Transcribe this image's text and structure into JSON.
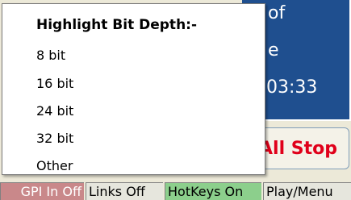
{
  "background_panel": {
    "text_top": "of",
    "text_mid": "e",
    "time": "03:33"
  },
  "all_stop_button": {
    "label": "All Stop",
    "color": "#e0001a"
  },
  "status_bar": {
    "gpi": "GPI In Off",
    "links": "Links Off",
    "hotkeys": "HotKeys On",
    "play_menu": "Play/Menu"
  },
  "context_menu": {
    "header": "Highlight Bit Depth:-",
    "items": [
      "8 bit",
      "16 bit",
      "24 bit",
      "32 bit",
      "Other"
    ]
  }
}
